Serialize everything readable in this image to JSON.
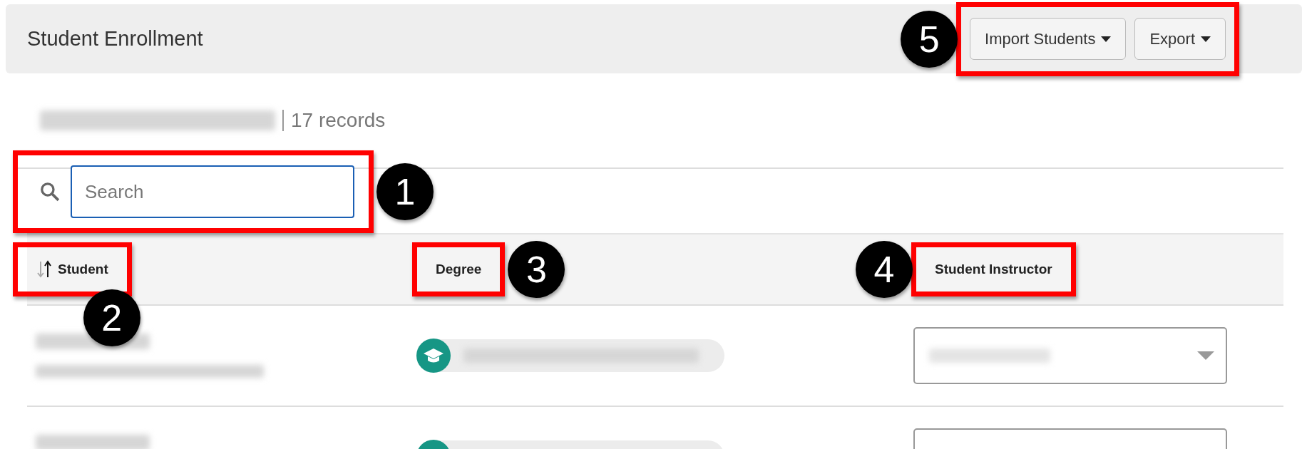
{
  "page_header": {
    "title": "Student Enrollment",
    "callout": "5",
    "actions": [
      {
        "label": "Import Students",
        "dropdown": true
      },
      {
        "label": "Export",
        "dropdown": true
      }
    ]
  },
  "summary": {
    "records": "17 records"
  },
  "search": {
    "placeholder": "Search",
    "callout": "1"
  },
  "columns": [
    {
      "label": "Student",
      "sortable": true,
      "callout": "2"
    },
    {
      "label": "Degree",
      "callout": "3"
    },
    {
      "label": "Student Instructor",
      "callout": "4"
    }
  ],
  "rows": [
    {
      "kind": "redacted"
    },
    {
      "kind": "redacted_partial"
    }
  ]
}
